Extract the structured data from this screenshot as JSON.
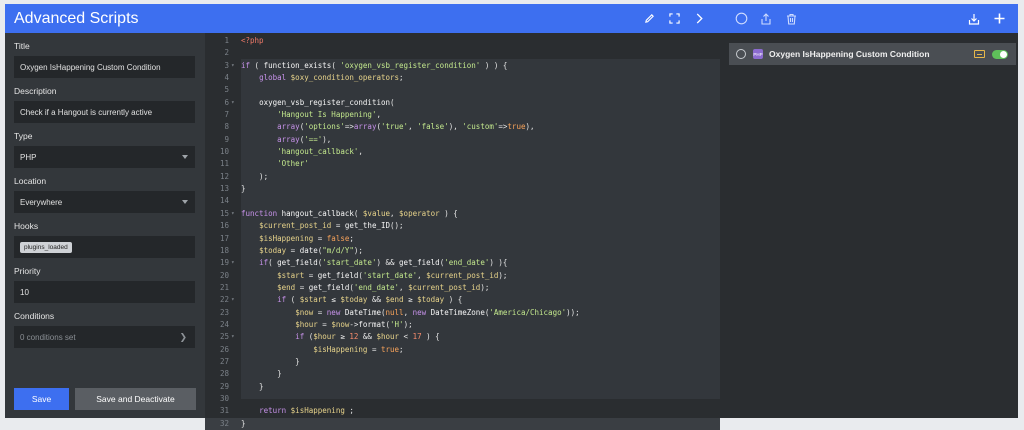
{
  "header": {
    "title": "Advanced Scripts",
    "edit_icon": "pencil-icon",
    "fullscreen_icon": "expand-icon",
    "collapse_icon": "chevron-right-icon"
  },
  "right_toolbar": {
    "icons": [
      "circle-icon",
      "share-icon",
      "trash-icon",
      "import-icon",
      "plus-icon"
    ]
  },
  "form": {
    "title_label": "Title",
    "title_value": "Oxygen IsHappening Custom Condition",
    "description_label": "Description",
    "description_value": "Check if a Hangout is currently active",
    "type_label": "Type",
    "type_value": "PHP",
    "location_label": "Location",
    "location_value": "Everywhere",
    "hooks_label": "Hooks",
    "hooks_value": "plugins_loaded",
    "priority_label": "Priority",
    "priority_value": "10",
    "conditions_label": "Conditions",
    "conditions_value": "0 conditions set",
    "save_label": "Save",
    "save_deactivate_label": "Save and Deactivate"
  },
  "editor": {
    "lines": [
      {
        "n": "1",
        "fold": false,
        "html": "<span class='t-tag'>&lt;?php</span>"
      },
      {
        "n": "2",
        "fold": false,
        "html": ""
      },
      {
        "n": "3",
        "fold": true,
        "html": "<span class='t-kw'>if</span> ( <span class='t-fn'>function_exists</span>( <span class='t-str'>'oxygen_vsb_register_condition'</span> ) ) {"
      },
      {
        "n": "4",
        "fold": false,
        "html": "    <span class='t-kw'>global</span> <span class='t-var'>$oxy_condition_operators</span>;"
      },
      {
        "n": "5",
        "fold": false,
        "html": ""
      },
      {
        "n": "6",
        "fold": true,
        "html": "    <span class='t-fn'>oxygen_vsb_register_condition</span>("
      },
      {
        "n": "7",
        "fold": false,
        "html": "        <span class='t-str'>'Hangout Is Happening'</span>,"
      },
      {
        "n": "8",
        "fold": false,
        "html": "        <span class='t-kw'>array</span>(<span class='t-str'>'options'</span>=&gt;<span class='t-kw'>array</span>(<span class='t-str'>'true'</span>, <span class='t-str'>'false'</span>), <span class='t-str'>'custom'</span>=&gt;<span class='t-bool'>true</span>),"
      },
      {
        "n": "9",
        "fold": false,
        "html": "        <span class='t-kw'>array</span>(<span class='t-str'>'=='</span>),"
      },
      {
        "n": "10",
        "fold": false,
        "html": "        <span class='t-str'>'hangout_callback'</span>,"
      },
      {
        "n": "11",
        "fold": false,
        "html": "        <span class='t-str'>'Other'</span>"
      },
      {
        "n": "12",
        "fold": false,
        "html": "    );"
      },
      {
        "n": "13",
        "fold": false,
        "html": "}"
      },
      {
        "n": "14",
        "fold": false,
        "html": ""
      },
      {
        "n": "15",
        "fold": true,
        "html": "<span class='t-kw'>function</span> <span class='t-fn'>hangout_callback</span>( <span class='t-var'>$value</span>, <span class='t-var'>$operator</span> ) {"
      },
      {
        "n": "16",
        "fold": false,
        "html": "    <span class='t-var'>$current_post_id</span> = <span class='t-fn'>get_the_ID</span>();"
      },
      {
        "n": "17",
        "fold": false,
        "html": "    <span class='t-var'>$isHappening</span> = <span class='t-bool'>false</span>;"
      },
      {
        "n": "18",
        "fold": false,
        "html": "    <span class='t-var'>$today</span> = <span class='t-fn'>date</span>(<span class='t-str'>\"m/d/Y\"</span>);"
      },
      {
        "n": "19",
        "fold": true,
        "html": "    <span class='t-kw'>if</span>( <span class='t-fn'>get_field</span>(<span class='t-str'>'start_date'</span>) &amp;&amp; <span class='t-fn'>get_field</span>(<span class='t-str'>'end_date'</span>) ){"
      },
      {
        "n": "20",
        "fold": false,
        "html": "        <span class='t-var'>$start</span> = <span class='t-fn'>get_field</span>(<span class='t-str'>'start_date'</span>, <span class='t-var'>$current_post_id</span>);"
      },
      {
        "n": "21",
        "fold": false,
        "html": "        <span class='t-var'>$end</span> = <span class='t-fn'>get_field</span>(<span class='t-str'>'end_date'</span>, <span class='t-var'>$current_post_id</span>);"
      },
      {
        "n": "22",
        "fold": true,
        "html": "        <span class='t-kw'>if</span> ( <span class='t-var'>$start</span> &le; <span class='t-var'>$today</span> &amp;&amp; <span class='t-var'>$end</span> &ge; <span class='t-var'>$today</span> ) {"
      },
      {
        "n": "23",
        "fold": false,
        "html": "            <span class='t-var'>$now</span> = <span class='t-kw'>new</span> <span class='t-fn'>DateTime</span>(<span class='t-bool'>null</span>, <span class='t-kw'>new</span> <span class='t-fn'>DateTimeZone</span>(<span class='t-str'>'America/Chicago'</span>));"
      },
      {
        "n": "24",
        "fold": false,
        "html": "            <span class='t-var'>$hour</span> = <span class='t-var'>$now</span>-&gt;<span class='t-fn'>format</span>(<span class='t-str'>'H'</span>);"
      },
      {
        "n": "25",
        "fold": true,
        "html": "            <span class='t-kw'>if</span> (<span class='t-var'>$hour</span> &ge; <span class='t-num'>12</span> &amp;&amp; <span class='t-var'>$hour</span> &lt; <span class='t-num'>17</span> ) {"
      },
      {
        "n": "26",
        "fold": false,
        "html": "                <span class='t-var'>$isHappening</span> = <span class='t-bool'>true</span>;"
      },
      {
        "n": "27",
        "fold": false,
        "html": "            }"
      },
      {
        "n": "28",
        "fold": false,
        "html": "        }"
      },
      {
        "n": "29",
        "fold": false,
        "html": "    }"
      },
      {
        "n": "30",
        "fold": false,
        "html": ""
      },
      {
        "n": "31",
        "fold": false,
        "html": "    <span class='t-kw'>return</span> <span class='t-var'>$isHappening</span> ;"
      },
      {
        "n": "32",
        "fold": false,
        "html": "}"
      }
    ]
  },
  "scripts": [
    {
      "name": "Oxygen IsHappening Custom Condition",
      "badge": "php",
      "active": true
    }
  ]
}
